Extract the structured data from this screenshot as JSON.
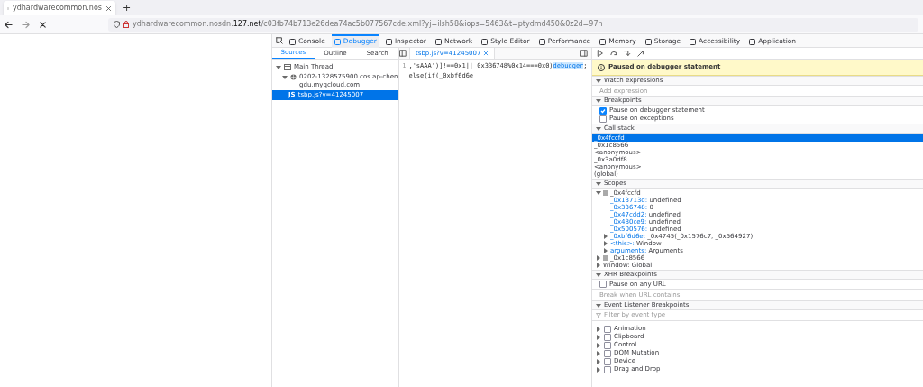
{
  "browser": {
    "tab_title": "ydhardwarecommon.nos",
    "new_tab": "+",
    "url_host": "ydhardwarecommon.nosdn.",
    "url_domain": "127.net",
    "url_path": "/c03fb74b713e26dea74ac5b077567cde.xml?yj=ilsh58&iops=5463&t=ptydmd450&0z2d=97n"
  },
  "tools": [
    {
      "label": "Console",
      "selected": false
    },
    {
      "label": "Debugger",
      "selected": true
    },
    {
      "label": "Inspector",
      "selected": false
    },
    {
      "label": "Network",
      "selected": false
    },
    {
      "label": "Style Editor",
      "selected": false
    },
    {
      "label": "Performance",
      "selected": false
    },
    {
      "label": "Memory",
      "selected": false
    },
    {
      "label": "Storage",
      "selected": false
    },
    {
      "label": "Accessibility",
      "selected": false
    },
    {
      "label": "Application",
      "selected": false
    }
  ],
  "sources": {
    "tabs": [
      {
        "label": "Sources",
        "selected": true
      },
      {
        "label": "Outline",
        "selected": false
      },
      {
        "label": "Search",
        "selected": false
      }
    ],
    "tree": [
      {
        "label": "Main Thread",
        "expanded": true,
        "selected": false,
        "children": [
          {
            "label": "0202-1328575900.cos.ap-chengdu.myqcloud.com",
            "expanded": true,
            "selected": false,
            "children": [
              {
                "icon": "JS",
                "label": "tsbp.js?v=41245007",
                "selected": true
              }
            ]
          }
        ]
      }
    ]
  },
  "editor": {
    "tab": "tsbp.js?v=41245007",
    "line_number": "1",
    "code_before": ",'sAAA')]!==0x1||_0x336748%0x14===0x0)",
    "code_match": "debugger",
    "code_after": ";else{if(_0xbf6d6e"
  },
  "pause_message": "Paused on debugger statement",
  "watch": {
    "title": "Watch expressions",
    "expanded": true,
    "placeholder": "Add expression"
  },
  "breakpoints": {
    "title": "Breakpoints",
    "expanded": true,
    "items": [
      {
        "label": "Pause on debugger statement",
        "checked": true
      },
      {
        "label": "Pause on exceptions",
        "checked": false
      }
    ]
  },
  "call_stack": {
    "title": "Call stack",
    "expanded": true,
    "frames": [
      {
        "label": "_0x4fccfd",
        "selected": true
      },
      {
        "label": "_0x1c8566",
        "selected": false
      },
      {
        "label": "<anonymous>",
        "selected": false
      },
      {
        "label": "_0x3a0df8",
        "selected": false
      },
      {
        "label": "<anonymous>",
        "selected": false
      },
      {
        "label": "(global)",
        "selected": false
      }
    ]
  },
  "scopes": {
    "title": "Scopes",
    "expanded": true,
    "tree": [
      {
        "label": "_0x4fccfd",
        "expanded": true,
        "children": [
          {
            "name": "_0x13713d:",
            "value": "undefined"
          },
          {
            "name": "_0x336748:",
            "value": "0"
          },
          {
            "name": "_0x47cdd2:",
            "value": "undefined"
          },
          {
            "name": "_0x480ce9:",
            "value": "undefined"
          },
          {
            "name": "_0x500576:",
            "value": "undefined"
          },
          {
            "name": "_0xbf6d6e:",
            "value": "_0x4745(_0x1576c7, _0x564927)",
            "expanded": false
          },
          {
            "name": "<this>:",
            "value": "Window",
            "expanded": false
          },
          {
            "name": "arguments:",
            "value": "Arguments",
            "expanded": false
          }
        ]
      },
      {
        "label": "_0x1c8566",
        "expanded": false
      },
      {
        "label": "Window: Global",
        "expanded": false
      }
    ]
  },
  "xhr": {
    "title": "XHR Breakpoints",
    "expanded": true,
    "any_url": {
      "label": "Pause on any URL",
      "checked": false
    },
    "placeholder": "Break when URL contains"
  },
  "events": {
    "title": "Event Listener Breakpoints",
    "expanded": true,
    "placeholder": "Filter by event type",
    "items": [
      {
        "label": "Animation",
        "checked": false,
        "expanded": false
      },
      {
        "label": "Clipboard",
        "checked": false,
        "expanded": false
      },
      {
        "label": "Control",
        "checked": false,
        "expanded": false
      },
      {
        "label": "DOM Mutation",
        "checked": false,
        "expanded": false
      },
      {
        "label": "Device",
        "checked": false,
        "expanded": false
      },
      {
        "label": "Drag and Drop",
        "checked": false,
        "expanded": false
      }
    ]
  }
}
